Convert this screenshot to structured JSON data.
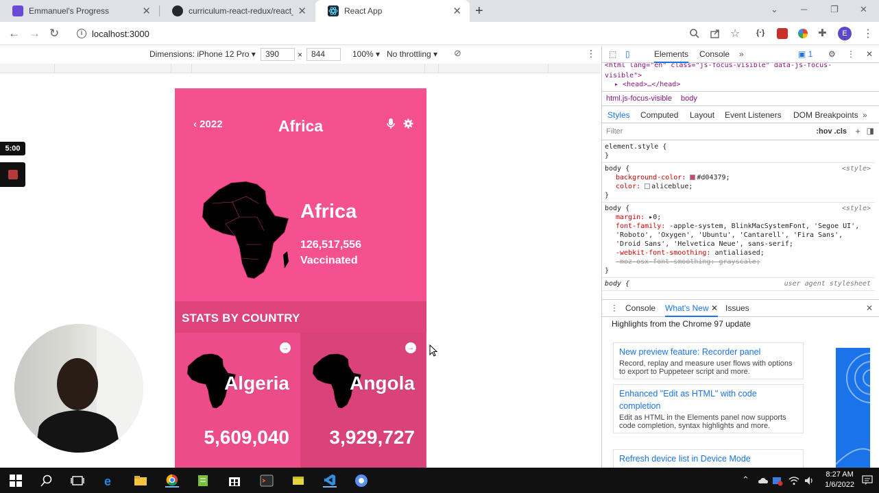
{
  "browser": {
    "tabs": [
      {
        "title": "Emmanuel's Progress",
        "favicon_color": "#6b48d8",
        "active": false
      },
      {
        "title": "curriculum-react-redux/react_cap",
        "favicon_color": "#24292f",
        "active": false
      },
      {
        "title": "React App",
        "favicon_color": "#1b2a3a",
        "active": true
      }
    ],
    "close_glyph": "✕",
    "new_tab_glyph": "+",
    "url": "localhost:3000",
    "profile_initial": "E"
  },
  "device_toolbar": {
    "dimensions_label": "Dimensions: iPhone 12 Pro",
    "width": "390",
    "times": "×",
    "height": "844",
    "zoom": "100%",
    "throttling": "No throttling"
  },
  "app": {
    "back_label": "2022",
    "title": "Africa",
    "hero": {
      "name": "Africa",
      "vaccinated_count": "126,517,556",
      "vaccinated_label": "Vaccinated"
    },
    "stats_title": "STATS BY COUNTRY",
    "countries": [
      {
        "name": "Algeria",
        "value": "5,609,040"
      },
      {
        "name": "Angola",
        "value": "3,929,727"
      }
    ],
    "colors": {
      "primary": "#ec4c8a",
      "header": "#f5508f",
      "stats_bar": "#de4379",
      "card_dark": "#d94379"
    }
  },
  "recording": {
    "timer": "5:00"
  },
  "devtools": {
    "tabs": [
      "Elements",
      "Console"
    ],
    "issues_count": "1",
    "dom_line1": "<html lang=\"en\" class=\"js-focus-visible\" data-js-focus-",
    "dom_line1b": "visible\">",
    "dom_line2": "<head>…</head>",
    "breadcrumbs": [
      "html.js-focus-visible",
      "body"
    ],
    "sub_tabs": [
      "Styles",
      "Computed",
      "Layout",
      "Event Listeners",
      "DOM Breakpoints"
    ],
    "filter_placeholder": "Filter",
    "filter_actions": ":hov  .cls",
    "rules": {
      "element_style": "element.style {",
      "close": "}",
      "body_sel": "body {",
      "style_src": "<style>",
      "bg_prop": "background-color:",
      "bg_val": "#d04379;",
      "bg_hex": "#d04379",
      "color_prop": "color:",
      "color_val": "aliceblue;",
      "margin_prop": "margin:",
      "margin_val": "0;",
      "font_prop": "font-family:",
      "font_val": "-apple-system, BlinkMacSystemFont, 'Segoe UI', 'Roboto', 'Oxygen', 'Ubuntu', 'Cantarell', 'Fira Sans', 'Droid Sans', 'Helvetica Neue', sans-serif;",
      "smooth_prop": "-webkit-font-smoothing:",
      "smooth_val": "antialiased;",
      "moz_line": "-moz-osx-font-smoothing: grayscale;",
      "ua_src": "user agent stylesheet"
    },
    "drawer_tabs": [
      "Console",
      "What's New",
      "Issues"
    ],
    "whats_new_heading": "Highlights from the Chrome 97 update",
    "whats_new": [
      {
        "title": "New preview feature: Recorder panel",
        "desc": "Record, replay and measure user flows with options to export to Puppeteer script and more."
      },
      {
        "title": "Enhanced \"Edit as HTML\" with code completion",
        "desc": "Edit as HTML in the Elements panel now supports code completion, syntax highlights and more."
      },
      {
        "title": "Refresh device list in Device Mode",
        "desc": ""
      }
    ]
  },
  "taskbar": {
    "time": "8:27 AM",
    "date": "1/6/2022"
  }
}
